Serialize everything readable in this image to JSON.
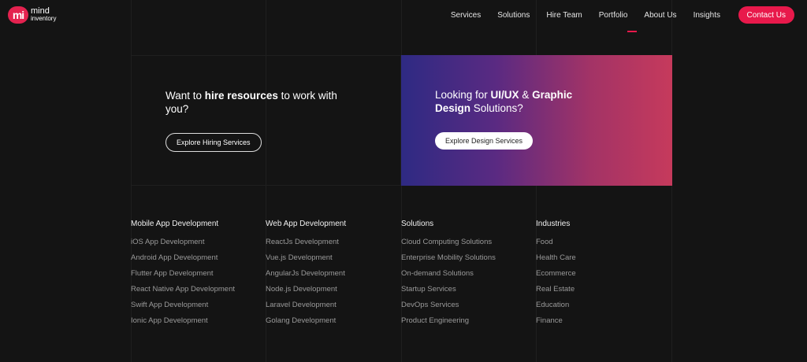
{
  "header": {
    "logo": {
      "mark": "mi",
      "line1": "mind",
      "line2": "inventory"
    },
    "nav": [
      "Services",
      "Solutions",
      "Hire Team",
      "Portfolio",
      "About Us",
      "Insights"
    ],
    "contact_label": "Contact Us"
  },
  "promo": {
    "hire": {
      "text_pre": "Want to ",
      "text_bold": "hire resources",
      "text_post": " to work with you?",
      "button": "Explore Hiring Services"
    },
    "design": {
      "text_pre": "Looking for ",
      "text_bold1": "UI/UX",
      "text_mid": " & ",
      "text_bold2": "Graphic Design",
      "text_post": " Solutions?",
      "button": "Explore Design Services"
    }
  },
  "footer": {
    "columns": [
      {
        "title": "Mobile App Development",
        "links": [
          "iOS App Development",
          "Android App Development",
          "Flutter App Development",
          "React Native App Development",
          "Swift App Development",
          "Ionic App Development"
        ]
      },
      {
        "title": "Web App Development",
        "links": [
          "ReactJs Development",
          "Vue.js Development",
          "AngularJs Development",
          "Node.js Development",
          "Laravel Development",
          "Golang Development"
        ]
      },
      {
        "title": "Solutions",
        "links": [
          "Cloud Computing Solutions",
          "Enterprise Mobility Solutions",
          "On-demand Solutions",
          "Startup Services",
          "DevOps Services",
          "Product Engineering"
        ]
      },
      {
        "title": "Industries",
        "links": [
          "Food",
          "Health Care",
          "Ecommerce",
          "Real Estate",
          "Education",
          "Finance"
        ]
      }
    ]
  },
  "colors": {
    "accent": "#e8194b",
    "background": "#141414",
    "link": "#9a9a9a"
  }
}
